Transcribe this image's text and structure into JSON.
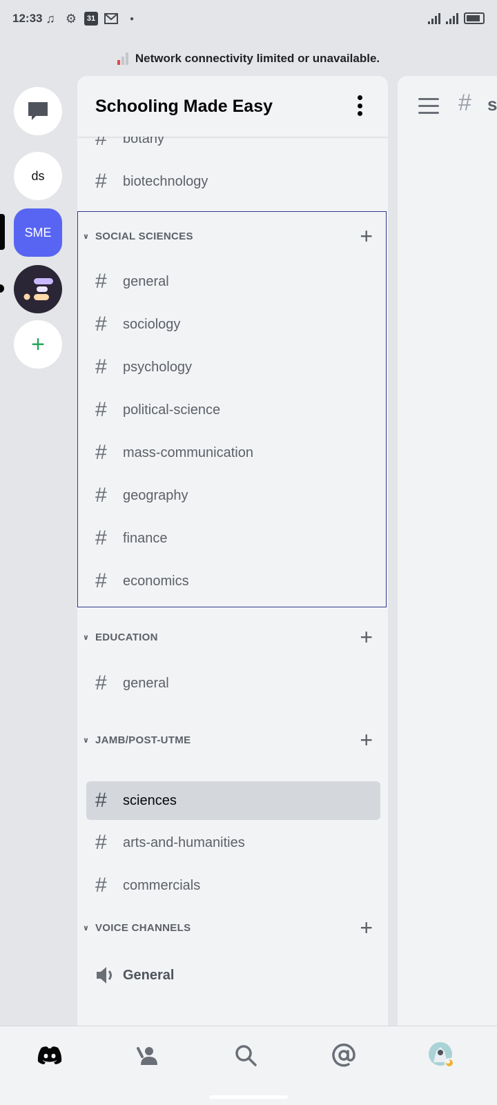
{
  "status_bar": {
    "time": "12:33",
    "calendar_day": "31",
    "icons": [
      "music-note-icon",
      "gear-icon",
      "calendar-icon",
      "mail-icon",
      "dot-icon"
    ],
    "right_icons": [
      "signal-icon",
      "signal-icon",
      "battery-icon"
    ]
  },
  "network_banner": {
    "text": "Network connectivity limited or unavailable."
  },
  "rail": {
    "servers": [
      {
        "label": "",
        "icon": "direct-messages-icon"
      },
      {
        "label": "ds"
      },
      {
        "label": "SME",
        "color": "#5865f2",
        "selected": true
      },
      {
        "label": "",
        "icon": "server-logo-icon"
      },
      {
        "label": "+",
        "icon": "add-server-icon",
        "color": "#23a55a"
      }
    ]
  },
  "server": {
    "name": "Schooling Made Easy"
  },
  "channels": {
    "top": [
      {
        "name": "botany"
      },
      {
        "name": "biotechnology"
      }
    ],
    "categories": [
      {
        "name": "SOCIAL SCIENCES",
        "channels": [
          "general",
          "sociology",
          "psychology",
          "political-science",
          "mass-communication",
          "geography",
          "finance",
          "economics"
        ]
      },
      {
        "name": "EDUCATION",
        "channels": [
          "general"
        ]
      },
      {
        "name": "JAMB/POST-UTME",
        "channels": [
          "sciences",
          "arts-and-humanities",
          "commercials"
        ],
        "selected": "sciences"
      },
      {
        "name": "VOICE CHANNELS",
        "voice_channels": [
          "General"
        ]
      }
    ]
  },
  "chat_peek": {
    "text": "s"
  },
  "bottom_nav": {
    "items": [
      "discord-home-icon",
      "friends-icon",
      "search-icon",
      "mentions-icon",
      "profile-avatar-icon"
    ]
  },
  "colors": {
    "accent": "#5865f2",
    "green": "#23a55a",
    "panel": "#f2f3f5",
    "background": "#e3e5e8"
  }
}
